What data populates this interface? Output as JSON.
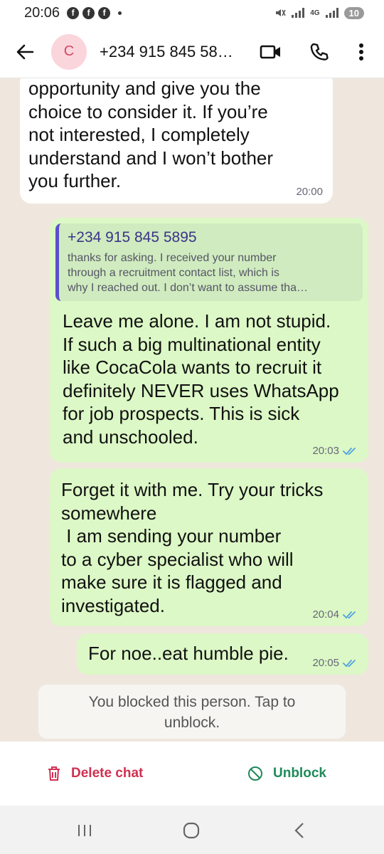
{
  "status_bar": {
    "time": "20:06",
    "notification_icons": [
      "facebook-icon",
      "facebook-icon",
      "facebook-icon"
    ],
    "network_type": "4G",
    "battery_level": "10"
  },
  "header": {
    "avatar_letter": "C",
    "contact_name": "+234 915 845 58…",
    "icons": [
      "back-arrow-icon",
      "video-call-icon",
      "phone-call-icon",
      "more-options-icon"
    ]
  },
  "messages": [
    {
      "direction": "incoming",
      "lines": [
        "opportunity and give you the",
        "choice to consider it. If you’re",
        "not interested, I completely",
        "understand and I won’t bother",
        "you further."
      ],
      "time": "20:00"
    },
    {
      "direction": "outgoing",
      "quote": {
        "author": "+234 915 845 5895",
        "lines": [
          "thanks for asking. I received your number",
          "through a recruitment contact list, which is",
          "why I reached out. I don’t want to assume tha…"
        ]
      },
      "lines": [
        "Leave me alone. I am not stupid.",
        "If such a big multinational entity",
        "like CocaCola wants to recruit it",
        "definitely NEVER uses WhatsApp",
        "for job prospects. This is sick",
        "and unschooled."
      ],
      "time": "20:03",
      "read": true
    },
    {
      "direction": "outgoing",
      "lines": [
        "Forget it with me. Try your tricks",
        "somewhere",
        " I am sending your number",
        "to a cyber specialist who will",
        "make sure it is flagged and",
        "investigated."
      ],
      "time": "20:04",
      "read": true
    },
    {
      "direction": "outgoing",
      "lines": [
        "For noe..eat humble pie."
      ],
      "time": "20:05",
      "read": true
    }
  ],
  "blocked_notice": {
    "lines": [
      "You blocked this person. Tap to",
      "unblock."
    ]
  },
  "actions": {
    "delete_label": "Delete chat",
    "unblock_label": "Unblock",
    "delete_color": "#d03050",
    "unblock_color": "#1f8a5a"
  },
  "nav_bar": {
    "icons": [
      "recent-apps-icon",
      "home-icon",
      "back-icon"
    ]
  },
  "colors": {
    "outgoing_bubble": "#dcf8c6",
    "incoming_bubble": "#ffffff",
    "chat_background": "#efe7de",
    "read_ticks": "#4fa3e0",
    "avatar_bg": "#fbd5dc"
  }
}
